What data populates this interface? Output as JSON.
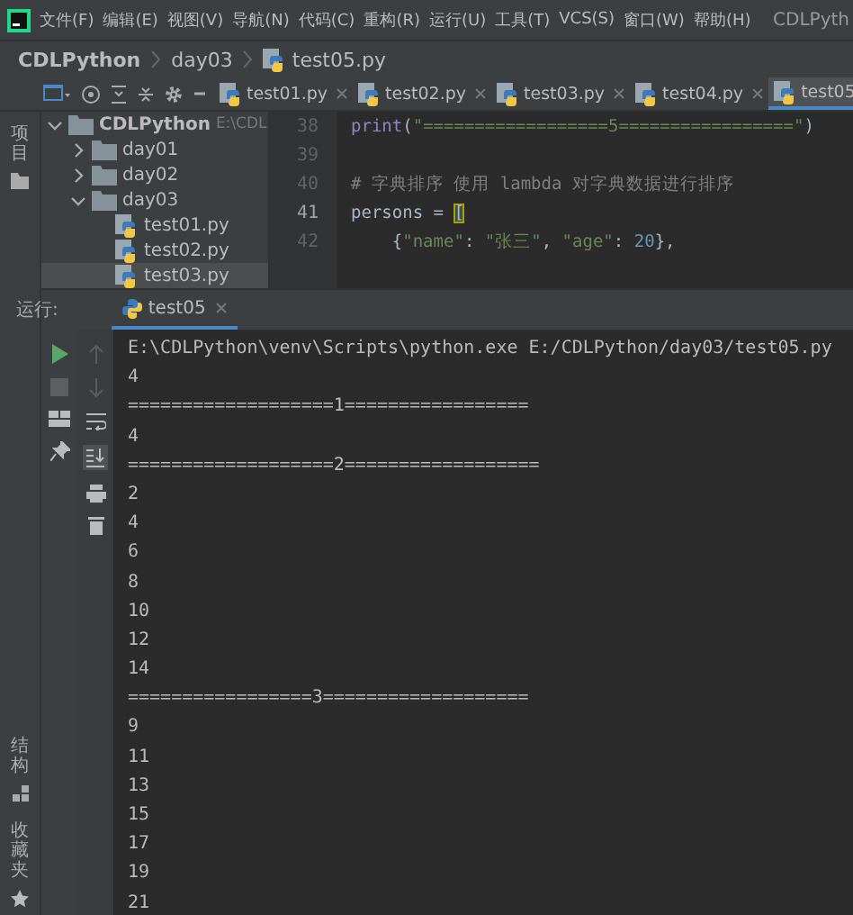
{
  "menu_bar": {
    "items": [
      "文件(F)",
      "编辑(E)",
      "视图(V)",
      "导航(N)",
      "代码(C)",
      "重构(R)",
      "运行(U)",
      "工具(T)",
      "VCS(S)",
      "窗口(W)",
      "帮助(H)"
    ],
    "window_title": "CDLPyth"
  },
  "breadcrumb": [
    "CDLPython",
    "day03",
    "test05.py"
  ],
  "editor_tabs": [
    {
      "label": "test01.py",
      "selected": false
    },
    {
      "label": "test02.py",
      "selected": false
    },
    {
      "label": "test03.py",
      "selected": false
    },
    {
      "label": "test04.py",
      "selected": false
    },
    {
      "label": "test05",
      "selected": true
    }
  ],
  "side_labels": [
    {
      "text": "项目",
      "kind": "project"
    },
    {
      "text": "结构",
      "kind": "structure"
    },
    {
      "text": "收藏夹",
      "kind": "favorites"
    }
  ],
  "project_tree": [
    {
      "kind": "folder",
      "name": "CDLPython",
      "path": "E:\\CDL",
      "expanded": true,
      "selected": false,
      "children": [
        {
          "kind": "folder",
          "name": "day01",
          "expanded": false,
          "selected": false
        },
        {
          "kind": "folder",
          "name": "day02",
          "expanded": false,
          "selected": false
        },
        {
          "kind": "folder",
          "name": "day03",
          "expanded": true,
          "selected": false,
          "children": [
            {
              "kind": "file",
              "name": "test01.py",
              "selected": false
            },
            {
              "kind": "file",
              "name": "test02.py",
              "selected": false
            },
            {
              "kind": "file",
              "name": "test03.py",
              "selected": true
            }
          ]
        }
      ]
    }
  ],
  "code_lines": [
    {
      "number": "38",
      "current": false,
      "tokens": [
        {
          "kind": "builtin",
          "text": "print"
        },
        {
          "kind": "plain",
          "text": "("
        },
        {
          "kind": "string",
          "text": "\"==================5=================\""
        },
        {
          "kind": "plain",
          "text": ")"
        }
      ]
    },
    {
      "number": "39",
      "current": false
    },
    {
      "number": "40",
      "current": false,
      "tokens": [
        {
          "kind": "comment",
          "text": "# 字典排序 使用 lambda 对字典数据进行排序"
        }
      ]
    },
    {
      "number": "41",
      "current": true,
      "tokens": [
        {
          "kind": "plain",
          "text": "persons = "
        },
        {
          "kind": "bracket",
          "text": "["
        }
      ]
    },
    {
      "number": "42",
      "current": false,
      "tokens": [
        {
          "kind": "plain",
          "text": "    {"
        },
        {
          "kind": "string",
          "text": "\"name\""
        },
        {
          "kind": "plain",
          "text": ": "
        },
        {
          "kind": "string",
          "text": "\"张三\""
        },
        {
          "kind": "plain",
          "text": ", "
        },
        {
          "kind": "string",
          "text": "\"age\""
        },
        {
          "kind": "plain",
          "text": ": "
        },
        {
          "kind": "number",
          "text": "20"
        },
        {
          "kind": "plain",
          "text": "},"
        }
      ]
    }
  ],
  "run_panel": {
    "label": "运行:",
    "tab": "test05",
    "output": [
      "E:\\CDLPython\\venv\\Scripts\\python.exe E:/CDLPython/day03/test05.py",
      "4",
      "===================1=================",
      "4",
      "===================2==================",
      "2",
      "4",
      "6",
      "8",
      "10",
      "12",
      "14",
      "=================3===================",
      "9",
      "11",
      "13",
      "15",
      "17",
      "19",
      "21"
    ]
  }
}
